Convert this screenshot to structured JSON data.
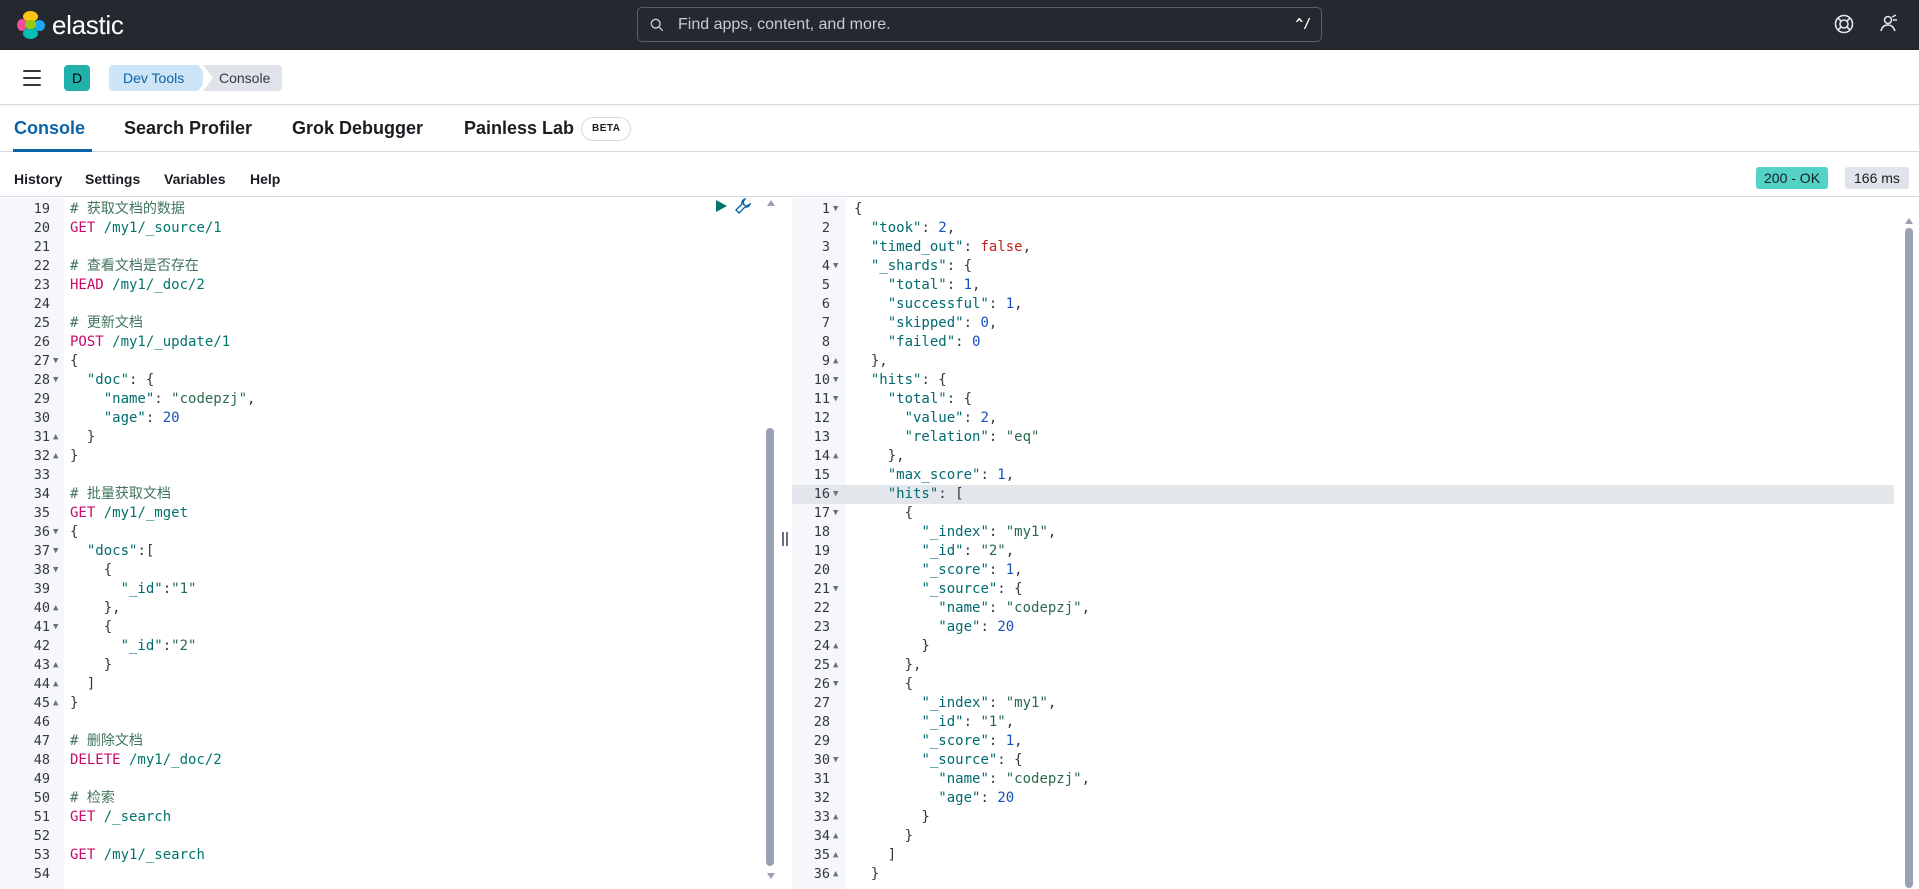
{
  "header": {
    "logo_text": "elastic",
    "search_placeholder": "Find apps, content, and more.",
    "search_shortcut": "^/",
    "help_icon": "help-lifebuoy-icon",
    "user_icon": "user-menu-icon"
  },
  "nav": {
    "avatar_letter": "D",
    "breadcrumbs": [
      "Dev Tools",
      "Console"
    ]
  },
  "tabs": [
    {
      "label": "Console",
      "active": true
    },
    {
      "label": "Search Profiler"
    },
    {
      "label": "Grok Debugger"
    },
    {
      "label": "Painless Lab",
      "badge": "BETA"
    }
  ],
  "toolbar": {
    "items": [
      "History",
      "Settings",
      "Variables",
      "Help"
    ],
    "status": "200 - OK",
    "duration": "166 ms"
  },
  "colors": {
    "header_bg": "#25282f",
    "accent": "#0b64a8",
    "status_ok": "#54d2c6"
  },
  "request_editor": {
    "lines": [
      {
        "n": "19",
        "t": [
          [
            "# 获取文档的数据",
            "c"
          ]
        ]
      },
      {
        "n": "20",
        "t": [
          [
            "GET",
            "m"
          ],
          [
            " /my1/_source/1",
            "u"
          ]
        ]
      },
      {
        "n": "21",
        "t": []
      },
      {
        "n": "22",
        "t": [
          [
            "# 查看文档是否存在",
            "c"
          ]
        ]
      },
      {
        "n": "23",
        "t": [
          [
            "HEAD",
            "m"
          ],
          [
            " /my1/_doc/2",
            "u"
          ]
        ]
      },
      {
        "n": "24",
        "t": []
      },
      {
        "n": "25",
        "t": [
          [
            "# 更新文档",
            "c"
          ]
        ]
      },
      {
        "n": "26",
        "t": [
          [
            "POST",
            "m"
          ],
          [
            " /my1/_update/1",
            "u"
          ]
        ]
      },
      {
        "n": "27",
        "f": "d",
        "t": [
          [
            "{",
            "p"
          ]
        ]
      },
      {
        "n": "28",
        "f": "d",
        "t": [
          [
            "  ",
            "p"
          ],
          [
            "\"doc\"",
            "k"
          ],
          [
            ": {",
            "p"
          ]
        ]
      },
      {
        "n": "29",
        "t": [
          [
            "    ",
            "p"
          ],
          [
            "\"name\"",
            "k"
          ],
          [
            ": ",
            "p"
          ],
          [
            "\"codepzj\"",
            "s"
          ],
          [
            ",",
            "p"
          ]
        ]
      },
      {
        "n": "30",
        "t": [
          [
            "    ",
            "p"
          ],
          [
            "\"age\"",
            "k"
          ],
          [
            ": ",
            "p"
          ],
          [
            "20",
            "n"
          ]
        ]
      },
      {
        "n": "31",
        "f": "u",
        "t": [
          [
            "  }",
            "p"
          ]
        ]
      },
      {
        "n": "32",
        "f": "u",
        "t": [
          [
            "}",
            "p"
          ]
        ]
      },
      {
        "n": "33",
        "t": []
      },
      {
        "n": "34",
        "t": [
          [
            "# 批量获取文档",
            "c"
          ]
        ]
      },
      {
        "n": "35",
        "t": [
          [
            "GET",
            "m"
          ],
          [
            " /my1/_mget",
            "u"
          ]
        ]
      },
      {
        "n": "36",
        "f": "d",
        "t": [
          [
            "{",
            "p"
          ]
        ]
      },
      {
        "n": "37",
        "f": "d",
        "t": [
          [
            "  ",
            "p"
          ],
          [
            "\"docs\"",
            "k"
          ],
          [
            ":[",
            "p"
          ]
        ]
      },
      {
        "n": "38",
        "f": "d",
        "t": [
          [
            "    {",
            "p"
          ]
        ]
      },
      {
        "n": "39",
        "t": [
          [
            "      ",
            "p"
          ],
          [
            "\"_id\"",
            "k"
          ],
          [
            ":",
            "p"
          ],
          [
            "\"1\"",
            "s"
          ]
        ]
      },
      {
        "n": "40",
        "f": "u",
        "t": [
          [
            "    },",
            "p"
          ]
        ]
      },
      {
        "n": "41",
        "f": "d",
        "t": [
          [
            "    {",
            "p"
          ]
        ]
      },
      {
        "n": "42",
        "t": [
          [
            "      ",
            "p"
          ],
          [
            "\"_id\"",
            "k"
          ],
          [
            ":",
            "p"
          ],
          [
            "\"2\"",
            "s"
          ]
        ]
      },
      {
        "n": "43",
        "f": "u",
        "t": [
          [
            "    }",
            "p"
          ]
        ]
      },
      {
        "n": "44",
        "f": "u",
        "t": [
          [
            "  ]",
            "p"
          ]
        ]
      },
      {
        "n": "45",
        "f": "u",
        "t": [
          [
            "}",
            "p"
          ]
        ]
      },
      {
        "n": "46",
        "t": []
      },
      {
        "n": "47",
        "t": [
          [
            "# 删除文档",
            "c"
          ]
        ]
      },
      {
        "n": "48",
        "t": [
          [
            "DELETE",
            "m"
          ],
          [
            " /my1/_doc/2",
            "u"
          ]
        ]
      },
      {
        "n": "49",
        "t": []
      },
      {
        "n": "50",
        "t": [
          [
            "# 检索",
            "c"
          ]
        ]
      },
      {
        "n": "51",
        "t": [
          [
            "GET",
            "m"
          ],
          [
            " /_search",
            "u"
          ]
        ]
      },
      {
        "n": "52",
        "t": []
      },
      {
        "n": "53",
        "t": [
          [
            "GET",
            "m"
          ],
          [
            " /my1/_search",
            "u"
          ]
        ]
      },
      {
        "n": "54",
        "t": []
      }
    ]
  },
  "response_editor": {
    "lines": [
      {
        "n": "1",
        "f": "d",
        "t": [
          [
            "{",
            "p"
          ]
        ]
      },
      {
        "n": "2",
        "t": [
          [
            "  ",
            "p"
          ],
          [
            "\"took\"",
            "k"
          ],
          [
            ": ",
            "p"
          ],
          [
            "2",
            "n"
          ],
          [
            ",",
            "p"
          ]
        ]
      },
      {
        "n": "3",
        "t": [
          [
            "  ",
            "p"
          ],
          [
            "\"timed_out\"",
            "k"
          ],
          [
            ": ",
            "p"
          ],
          [
            "false",
            "b"
          ],
          [
            ",",
            "p"
          ]
        ]
      },
      {
        "n": "4",
        "f": "d",
        "t": [
          [
            "  ",
            "p"
          ],
          [
            "\"_shards\"",
            "k"
          ],
          [
            ": {",
            "p"
          ]
        ]
      },
      {
        "n": "5",
        "t": [
          [
            "    ",
            "p"
          ],
          [
            "\"total\"",
            "k"
          ],
          [
            ": ",
            "p"
          ],
          [
            "1",
            "n"
          ],
          [
            ",",
            "p"
          ]
        ]
      },
      {
        "n": "6",
        "t": [
          [
            "    ",
            "p"
          ],
          [
            "\"successful\"",
            "k"
          ],
          [
            ": ",
            "p"
          ],
          [
            "1",
            "n"
          ],
          [
            ",",
            "p"
          ]
        ]
      },
      {
        "n": "7",
        "t": [
          [
            "    ",
            "p"
          ],
          [
            "\"skipped\"",
            "k"
          ],
          [
            ": ",
            "p"
          ],
          [
            "0",
            "n"
          ],
          [
            ",",
            "p"
          ]
        ]
      },
      {
        "n": "8",
        "t": [
          [
            "    ",
            "p"
          ],
          [
            "\"failed\"",
            "k"
          ],
          [
            ": ",
            "p"
          ],
          [
            "0",
            "n"
          ]
        ]
      },
      {
        "n": "9",
        "f": "u",
        "t": [
          [
            "  },",
            "p"
          ]
        ]
      },
      {
        "n": "10",
        "f": "d",
        "t": [
          [
            "  ",
            "p"
          ],
          [
            "\"hits\"",
            "k"
          ],
          [
            ": {",
            "p"
          ]
        ]
      },
      {
        "n": "11",
        "f": "d",
        "t": [
          [
            "    ",
            "p"
          ],
          [
            "\"total\"",
            "k"
          ],
          [
            ": {",
            "p"
          ]
        ]
      },
      {
        "n": "12",
        "t": [
          [
            "      ",
            "p"
          ],
          [
            "\"value\"",
            "k"
          ],
          [
            ": ",
            "p"
          ],
          [
            "2",
            "n"
          ],
          [
            ",",
            "p"
          ]
        ]
      },
      {
        "n": "13",
        "t": [
          [
            "      ",
            "p"
          ],
          [
            "\"relation\"",
            "k"
          ],
          [
            ": ",
            "p"
          ],
          [
            "\"eq\"",
            "s"
          ]
        ]
      },
      {
        "n": "14",
        "f": "u",
        "t": [
          [
            "    },",
            "p"
          ]
        ]
      },
      {
        "n": "15",
        "t": [
          [
            "    ",
            "p"
          ],
          [
            "\"max_score\"",
            "k"
          ],
          [
            ": ",
            "p"
          ],
          [
            "1",
            "n"
          ],
          [
            ",",
            "p"
          ]
        ]
      },
      {
        "n": "16",
        "f": "d",
        "hl": true,
        "t": [
          [
            "    ",
            "p"
          ],
          [
            "\"hits\"",
            "k"
          ],
          [
            ": [",
            "p"
          ]
        ]
      },
      {
        "n": "17",
        "f": "d",
        "t": [
          [
            "      {",
            "p"
          ]
        ]
      },
      {
        "n": "18",
        "t": [
          [
            "        ",
            "p"
          ],
          [
            "\"_index\"",
            "k"
          ],
          [
            ": ",
            "p"
          ],
          [
            "\"my1\"",
            "s"
          ],
          [
            ",",
            "p"
          ]
        ]
      },
      {
        "n": "19",
        "t": [
          [
            "        ",
            "p"
          ],
          [
            "\"_id\"",
            "k"
          ],
          [
            ": ",
            "p"
          ],
          [
            "\"2\"",
            "s"
          ],
          [
            ",",
            "p"
          ]
        ]
      },
      {
        "n": "20",
        "t": [
          [
            "        ",
            "p"
          ],
          [
            "\"_score\"",
            "k"
          ],
          [
            ": ",
            "p"
          ],
          [
            "1",
            "n"
          ],
          [
            ",",
            "p"
          ]
        ]
      },
      {
        "n": "21",
        "f": "d",
        "t": [
          [
            "        ",
            "p"
          ],
          [
            "\"_source\"",
            "k"
          ],
          [
            ": {",
            "p"
          ]
        ]
      },
      {
        "n": "22",
        "t": [
          [
            "          ",
            "p"
          ],
          [
            "\"name\"",
            "k"
          ],
          [
            ": ",
            "p"
          ],
          [
            "\"codepzj\"",
            "s"
          ],
          [
            ",",
            "p"
          ]
        ]
      },
      {
        "n": "23",
        "t": [
          [
            "          ",
            "p"
          ],
          [
            "\"age\"",
            "k"
          ],
          [
            ": ",
            "p"
          ],
          [
            "20",
            "n"
          ]
        ]
      },
      {
        "n": "24",
        "f": "u",
        "t": [
          [
            "        }",
            "p"
          ]
        ]
      },
      {
        "n": "25",
        "f": "u",
        "t": [
          [
            "      },",
            "p"
          ]
        ]
      },
      {
        "n": "26",
        "f": "d",
        "t": [
          [
            "      {",
            "p"
          ]
        ]
      },
      {
        "n": "27",
        "t": [
          [
            "        ",
            "p"
          ],
          [
            "\"_index\"",
            "k"
          ],
          [
            ": ",
            "p"
          ],
          [
            "\"my1\"",
            "s"
          ],
          [
            ",",
            "p"
          ]
        ]
      },
      {
        "n": "28",
        "t": [
          [
            "        ",
            "p"
          ],
          [
            "\"_id\"",
            "k"
          ],
          [
            ": ",
            "p"
          ],
          [
            "\"1\"",
            "s"
          ],
          [
            ",",
            "p"
          ]
        ]
      },
      {
        "n": "29",
        "t": [
          [
            "        ",
            "p"
          ],
          [
            "\"_score\"",
            "k"
          ],
          [
            ": ",
            "p"
          ],
          [
            "1",
            "n"
          ],
          [
            ",",
            "p"
          ]
        ]
      },
      {
        "n": "30",
        "f": "d",
        "t": [
          [
            "        ",
            "p"
          ],
          [
            "\"_source\"",
            "k"
          ],
          [
            ": {",
            "p"
          ]
        ]
      },
      {
        "n": "31",
        "t": [
          [
            "          ",
            "p"
          ],
          [
            "\"name\"",
            "k"
          ],
          [
            ": ",
            "p"
          ],
          [
            "\"codepzj\"",
            "s"
          ],
          [
            ",",
            "p"
          ]
        ]
      },
      {
        "n": "32",
        "t": [
          [
            "          ",
            "p"
          ],
          [
            "\"age\"",
            "k"
          ],
          [
            ": ",
            "p"
          ],
          [
            "20",
            "n"
          ]
        ]
      },
      {
        "n": "33",
        "f": "u",
        "t": [
          [
            "        }",
            "p"
          ]
        ]
      },
      {
        "n": "34",
        "f": "u",
        "t": [
          [
            "      }",
            "p"
          ]
        ]
      },
      {
        "n": "35",
        "f": "u",
        "t": [
          [
            "    ]",
            "p"
          ]
        ]
      },
      {
        "n": "36",
        "f": "u",
        "t": [
          [
            "  }",
            "p"
          ]
        ]
      }
    ]
  }
}
